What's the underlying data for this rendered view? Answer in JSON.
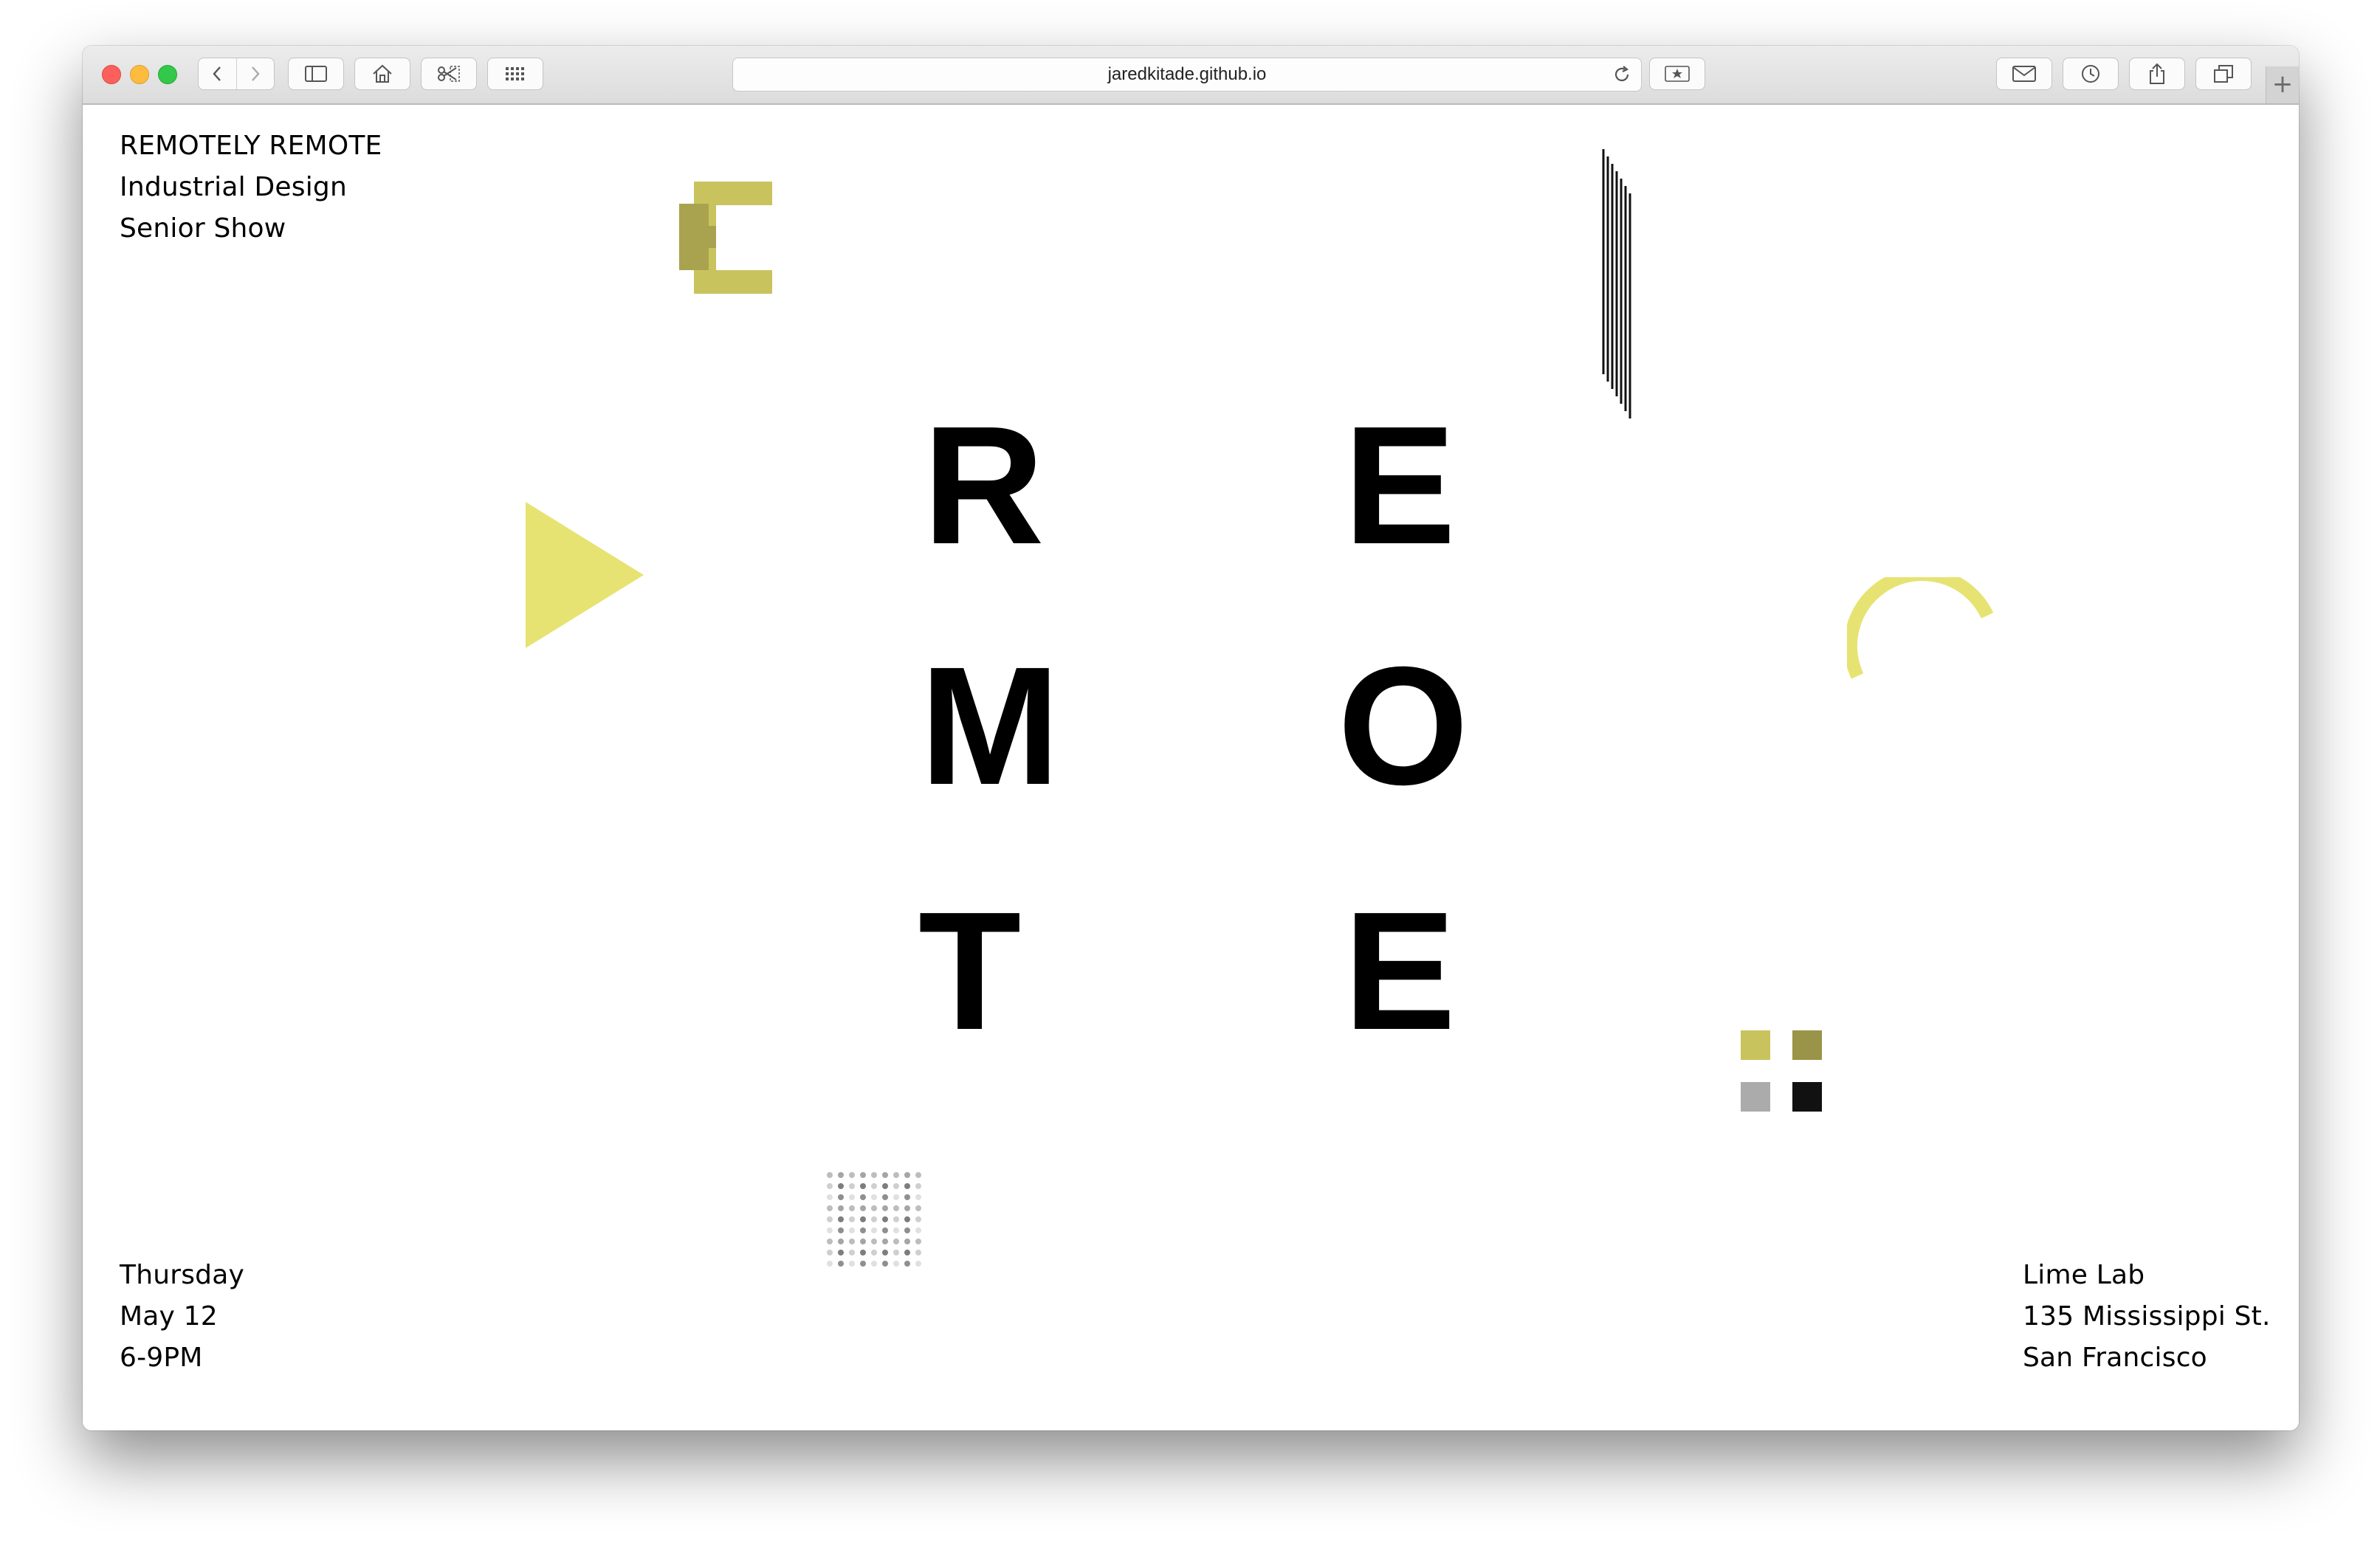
{
  "browser": {
    "url": "jaredkitade.github.io"
  },
  "header_info": {
    "line1": "REMOTELY REMOTE",
    "line2": "Industrial Design",
    "line3": "Senior Show"
  },
  "letters": [
    "R",
    "E",
    "M",
    "O",
    "T",
    "E"
  ],
  "event": {
    "day": "Thursday",
    "date": "May 12",
    "time": "6-9PM"
  },
  "venue": {
    "name": "Lime Lab",
    "street": "135 Mississippi St.",
    "city": "San Francisco"
  },
  "colors": {
    "lime": "#e6e373",
    "olive": "#c9c35e",
    "dark_olive": "#9a9448",
    "gray": "#ababab",
    "black": "#111111"
  },
  "icons": [
    "sidebar-icon",
    "home-icon",
    "clip-icon",
    "grid-icon",
    "bookmark-icon",
    "mail-icon",
    "history-icon",
    "share-icon",
    "tabs-icon",
    "reload-icon"
  ]
}
